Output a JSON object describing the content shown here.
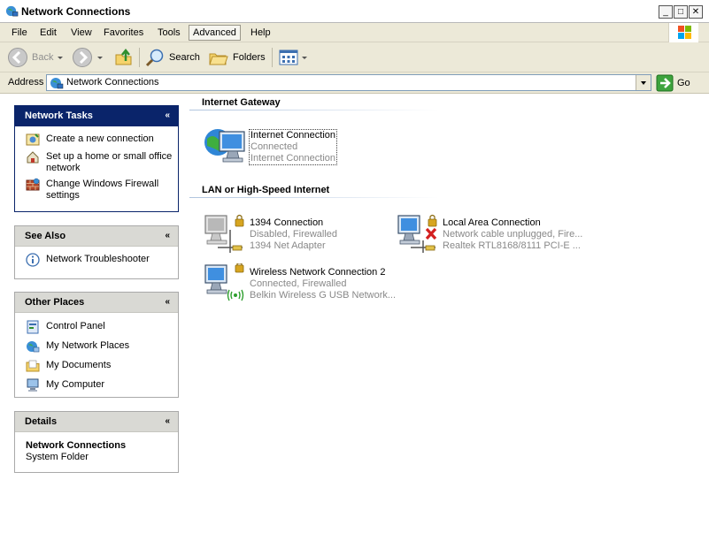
{
  "window": {
    "title": "Network Connections",
    "controls": {
      "minimize": "_",
      "maximize": "□",
      "close": "✕"
    }
  },
  "menu": {
    "items": [
      "File",
      "Edit",
      "View",
      "Favorites",
      "Tools",
      "Advanced",
      "Help"
    ],
    "active": "Advanced"
  },
  "toolbar": {
    "back_label": "Back",
    "search_label": "Search",
    "folders_label": "Folders"
  },
  "address": {
    "label": "Address",
    "value": "Network Connections",
    "go_label": "Go"
  },
  "sidebar": {
    "network_tasks": {
      "title": "Network Tasks",
      "collapse": "«",
      "items": [
        {
          "label": "Create a new connection",
          "icon": "new-connection-icon"
        },
        {
          "label": "Set up a home or small office network",
          "icon": "home-network-icon"
        },
        {
          "label": "Change Windows Firewall settings",
          "icon": "firewall-icon"
        }
      ]
    },
    "see_also": {
      "title": "See Also",
      "collapse": "«",
      "items": [
        {
          "label": "Network Troubleshooter",
          "icon": "info-icon"
        }
      ]
    },
    "other_places": {
      "title": "Other Places",
      "collapse": "«",
      "items": [
        {
          "label": "Control Panel",
          "icon": "control-panel-icon"
        },
        {
          "label": "My Network Places",
          "icon": "network-places-icon"
        },
        {
          "label": "My Documents",
          "icon": "documents-folder-icon"
        },
        {
          "label": "My Computer",
          "icon": "computer-icon"
        }
      ]
    },
    "details": {
      "title": "Details",
      "collapse": "«",
      "name": "Network Connections",
      "type": "System Folder"
    }
  },
  "content": {
    "groups": [
      {
        "title": "Internet Gateway",
        "connections": [
          {
            "name": "Internet Connection",
            "status": "Connected",
            "device": "Internet Connection",
            "icon": "internet-gateway-icon",
            "selected": true
          }
        ]
      },
      {
        "title": "LAN or High-Speed Internet",
        "connections": [
          {
            "name": "1394 Connection",
            "status": "Disabled, Firewalled",
            "device": "1394 Net Adapter",
            "icon": "network-adapter-disabled-icon"
          },
          {
            "name": "Local Area Connection",
            "status": "Network cable unplugged, Fire...",
            "device": "Realtek RTL8168/8111 PCI-E ...",
            "icon": "network-cable-unplugged-icon"
          },
          {
            "name": "Wireless Network Connection 2",
            "status": "Connected, Firewalled",
            "device": "Belkin Wireless G USB Network...",
            "icon": "wireless-connection-icon"
          }
        ]
      }
    ]
  },
  "colors": {
    "chrome": "#ece9d8",
    "pane_header_primary": "#0a246a",
    "pane_header": "#d9d9d4",
    "status_text": "#888888"
  }
}
